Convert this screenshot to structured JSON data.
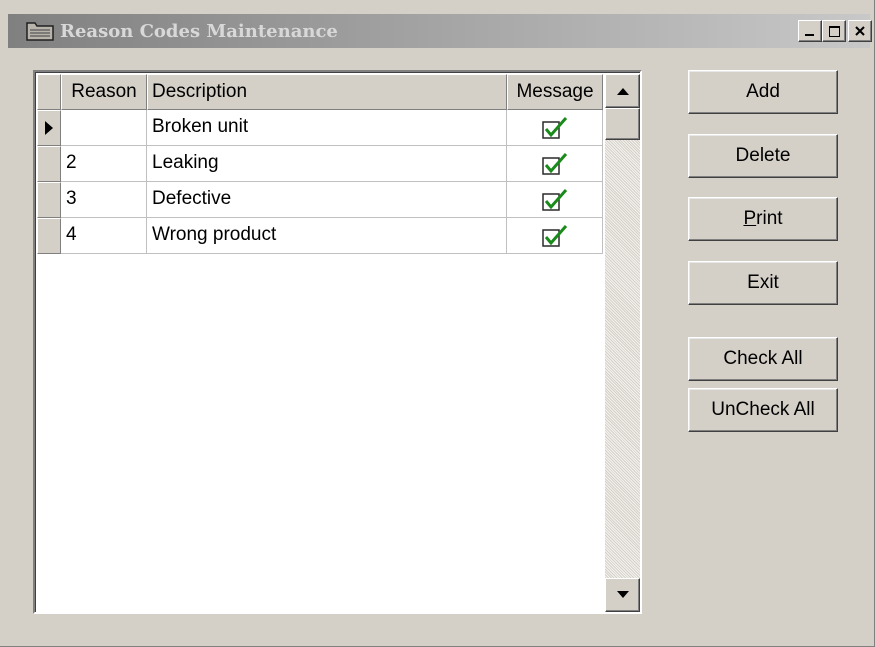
{
  "window": {
    "title": "Reason Codes Maintenance",
    "controls": {
      "minimize": "_",
      "maximize": "□",
      "close": "✕"
    }
  },
  "grid": {
    "columns": [
      "Reason",
      "Description",
      "Message"
    ],
    "current_row_indicator": "▶",
    "rows": [
      {
        "reason": "",
        "description": "Broken unit",
        "message_checked": true
      },
      {
        "reason": "2",
        "description": "Leaking",
        "message_checked": true
      },
      {
        "reason": "3",
        "description": "Defective",
        "message_checked": true
      },
      {
        "reason": "4",
        "description": "Wrong product",
        "message_checked": true
      }
    ]
  },
  "buttons": {
    "add": "Add",
    "delete": "Delete",
    "print_mnemonic": "P",
    "print_rest": "rint",
    "exit": "Exit",
    "check_all": "Check All",
    "uncheck_all": "UnCheck All"
  },
  "icons": {
    "window_icon": "folder-icon",
    "checkmark": "checkmark-icon",
    "scroll_up": "arrow-up-icon",
    "scroll_down": "arrow-down-icon"
  },
  "colors": {
    "face": "#d4d0c8",
    "check_green": "#1a8a1a"
  }
}
